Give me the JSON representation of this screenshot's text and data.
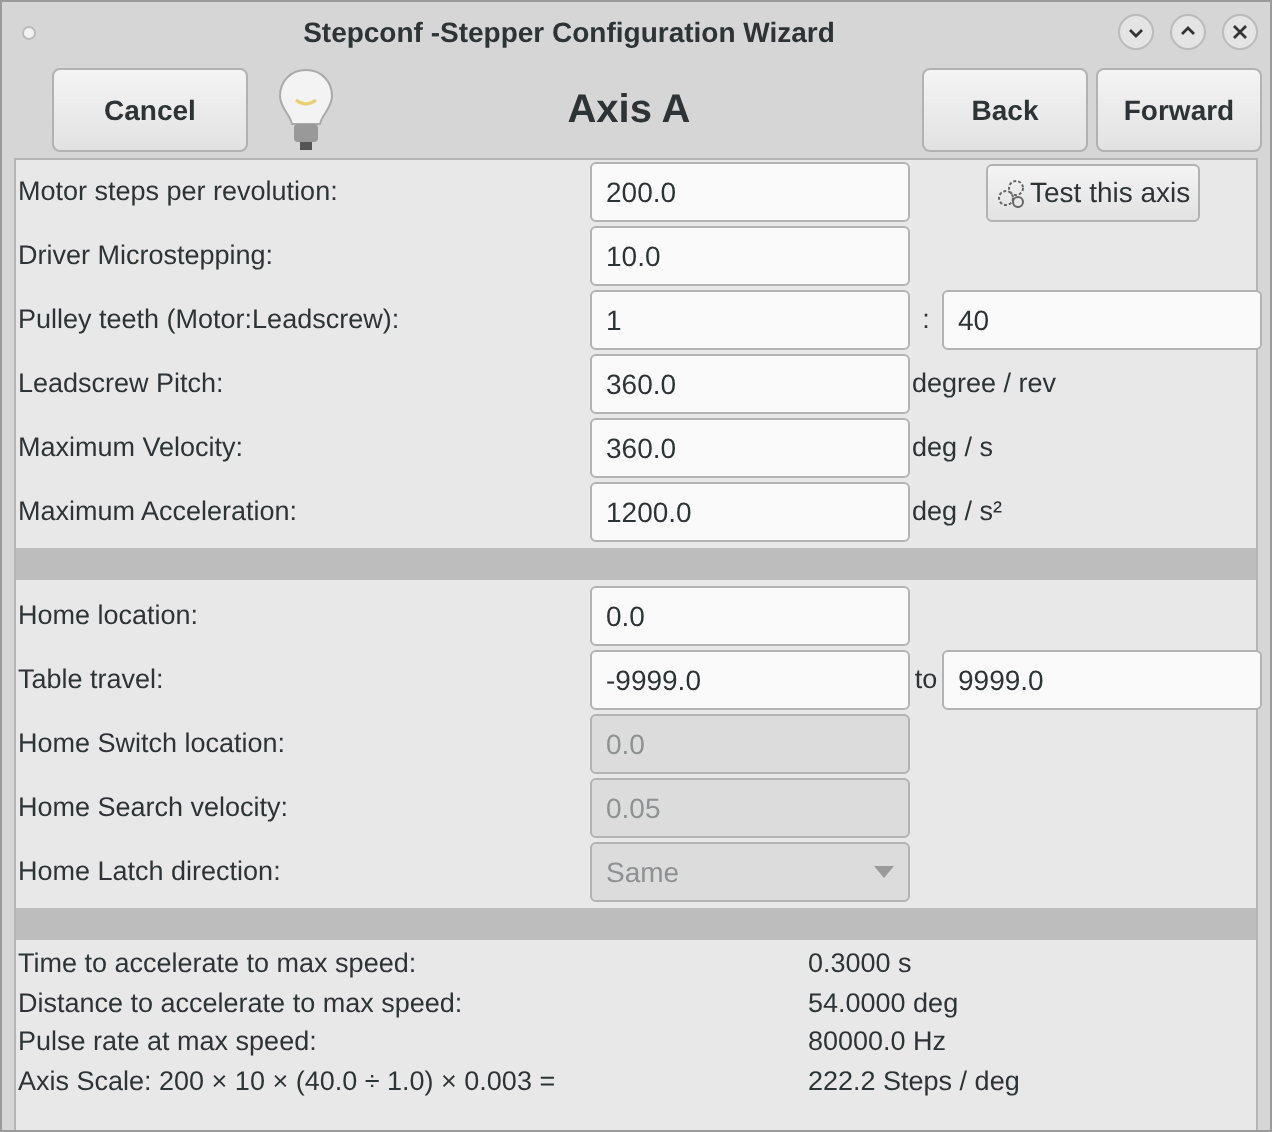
{
  "window": {
    "title": "Stepconf -Stepper Configuration Wizard"
  },
  "header": {
    "cancel": "Cancel",
    "title": "Axis A",
    "back": "Back",
    "forward": "Forward"
  },
  "test_button": "Test this axis",
  "motor_fields": [
    {
      "kind": "text",
      "label": "Motor steps per revolution:",
      "value": "200.0"
    },
    {
      "kind": "text",
      "label": "Driver Microstepping:",
      "value": "10.0"
    },
    {
      "kind": "pair",
      "label": "Pulley teeth (Motor:Leadscrew):",
      "value": "1",
      "separator": ":",
      "value2": "40"
    },
    {
      "kind": "unit",
      "label": "Leadscrew Pitch:",
      "value": "360.0",
      "unit": "degree / rev"
    },
    {
      "kind": "unit",
      "label": "Maximum Velocity:",
      "value": "360.0",
      "unit": "deg / s"
    },
    {
      "kind": "unit",
      "label": "Maximum Acceleration:",
      "value": "1200.0",
      "unit": "deg / s²"
    }
  ],
  "home_fields": [
    {
      "kind": "text",
      "label": "Home location:",
      "value": "0.0",
      "disabled": false
    },
    {
      "kind": "pair",
      "label": "Table travel:",
      "value": "-9999.0",
      "separator": "to",
      "value2": "9999.0",
      "disabled": false
    },
    {
      "kind": "text",
      "label": "Home Switch location:",
      "value": "0.0",
      "disabled": true
    },
    {
      "kind": "text",
      "label": "Home Search velocity:",
      "value": "0.05",
      "disabled": true
    },
    {
      "kind": "dropdown",
      "label": "Home Latch direction:",
      "value": "Same",
      "disabled": true
    }
  ],
  "results": [
    {
      "label": "Time to accelerate to max speed:",
      "value": "0.3000 s"
    },
    {
      "label": "Distance to accelerate to max speed:",
      "value": "54.0000 deg"
    },
    {
      "label": "Pulse rate at max speed:",
      "value": "80000.0 Hz"
    },
    {
      "label": "Axis Scale: 200 × 10 × (40.0 ÷ 1.0) × 0.003 =",
      "value": "222.2 Steps / deg"
    }
  ]
}
